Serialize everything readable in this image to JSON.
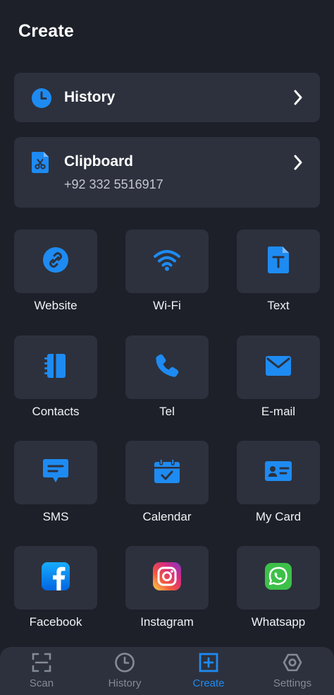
{
  "page": {
    "title": "Create"
  },
  "colors": {
    "background": "#1d2029",
    "card": "#2d313d",
    "accent": "#1e8bf2",
    "inactive": "#858a97"
  },
  "history_card": {
    "title": "History",
    "icon": "clock-icon"
  },
  "clipboard_card": {
    "title": "Clipboard",
    "value": "+92 332 5516917",
    "icon": "clipboard-file-icon"
  },
  "grid": [
    {
      "label": "Website",
      "icon": "link-icon"
    },
    {
      "label": "Wi-Fi",
      "icon": "wifi-icon"
    },
    {
      "label": "Text",
      "icon": "text-file-icon"
    },
    {
      "label": "Contacts",
      "icon": "contacts-book-icon"
    },
    {
      "label": "Tel",
      "icon": "phone-icon"
    },
    {
      "label": "E-mail",
      "icon": "envelope-icon"
    },
    {
      "label": "SMS",
      "icon": "message-icon"
    },
    {
      "label": "Calendar",
      "icon": "calendar-icon"
    },
    {
      "label": "My Card",
      "icon": "id-card-icon"
    },
    {
      "label": "Facebook",
      "icon": "facebook-icon"
    },
    {
      "label": "Instagram",
      "icon": "instagram-icon"
    },
    {
      "label": "Whatsapp",
      "icon": "whatsapp-icon"
    }
  ],
  "nav": [
    {
      "label": "Scan",
      "icon": "scan-icon"
    },
    {
      "label": "History",
      "icon": "history-clock-icon"
    },
    {
      "label": "Create",
      "icon": "plus-square-icon",
      "active": true
    },
    {
      "label": "Settings",
      "icon": "gear-icon"
    }
  ]
}
